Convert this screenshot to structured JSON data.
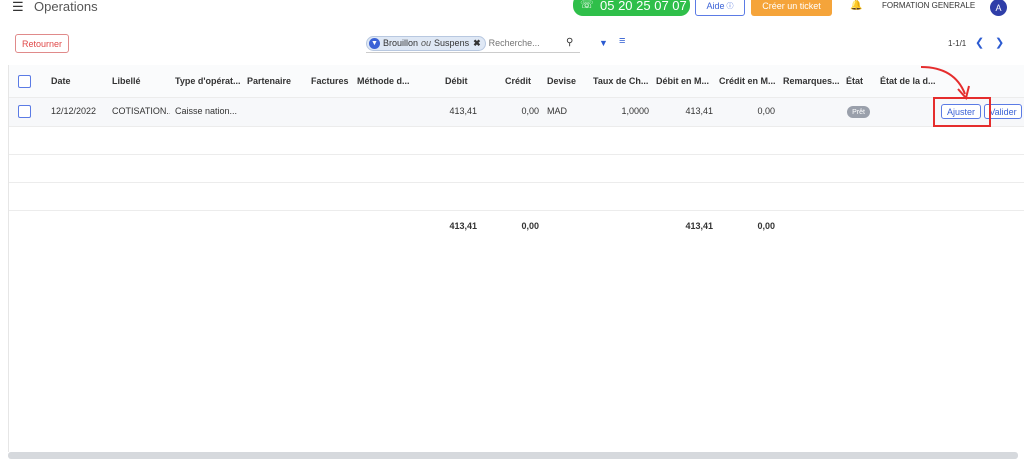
{
  "topbar": {
    "title": "Operations",
    "phone": "05 20 25 07 07",
    "help_label": "Aide",
    "ticket_label": "Créer un ticket",
    "company": "FORMATION GENERALE",
    "avatar_initial": "A"
  },
  "control": {
    "back_label": "Retourner",
    "facet_a": "Brouillon",
    "facet_or": "ou",
    "facet_b": "Suspens",
    "search_placeholder": "Recherche...",
    "pager": "1-1/1"
  },
  "table": {
    "headers": {
      "date": "Date",
      "libelle": "Libellé",
      "type": "Type d'opérat...",
      "partenaire": "Partenaire",
      "factures": "Factures",
      "methode": "Méthode d...",
      "debit": "Débit",
      "credit": "Crédit",
      "devise": "Devise",
      "taux": "Taux de Ch...",
      "debit_m": "Débit en M...",
      "credit_m": "Crédit en M...",
      "remarques": "Remarques...",
      "etat": "État",
      "etat_d": "État de la d..."
    },
    "rows": [
      {
        "date": "12/12/2022",
        "libelle": "COTISATION...",
        "type": "Caisse nation...",
        "debit": "413,41",
        "credit": "0,00",
        "devise": "MAD",
        "taux": "1,0000",
        "debit_m": "413,41",
        "credit_m": "0,00",
        "etat": "Prêt",
        "ajuster_label": "Ajuster",
        "valider_label": "Valider"
      }
    ],
    "totals": {
      "debit": "413,41",
      "credit": "0,00",
      "debit_m": "413,41",
      "credit_m": "0,00"
    }
  },
  "colors": {
    "primary": "#3b62d6",
    "phone_bg": "#2fbf4a",
    "ticket_bg": "#f5a43a",
    "annotation": "#e52d2d"
  }
}
